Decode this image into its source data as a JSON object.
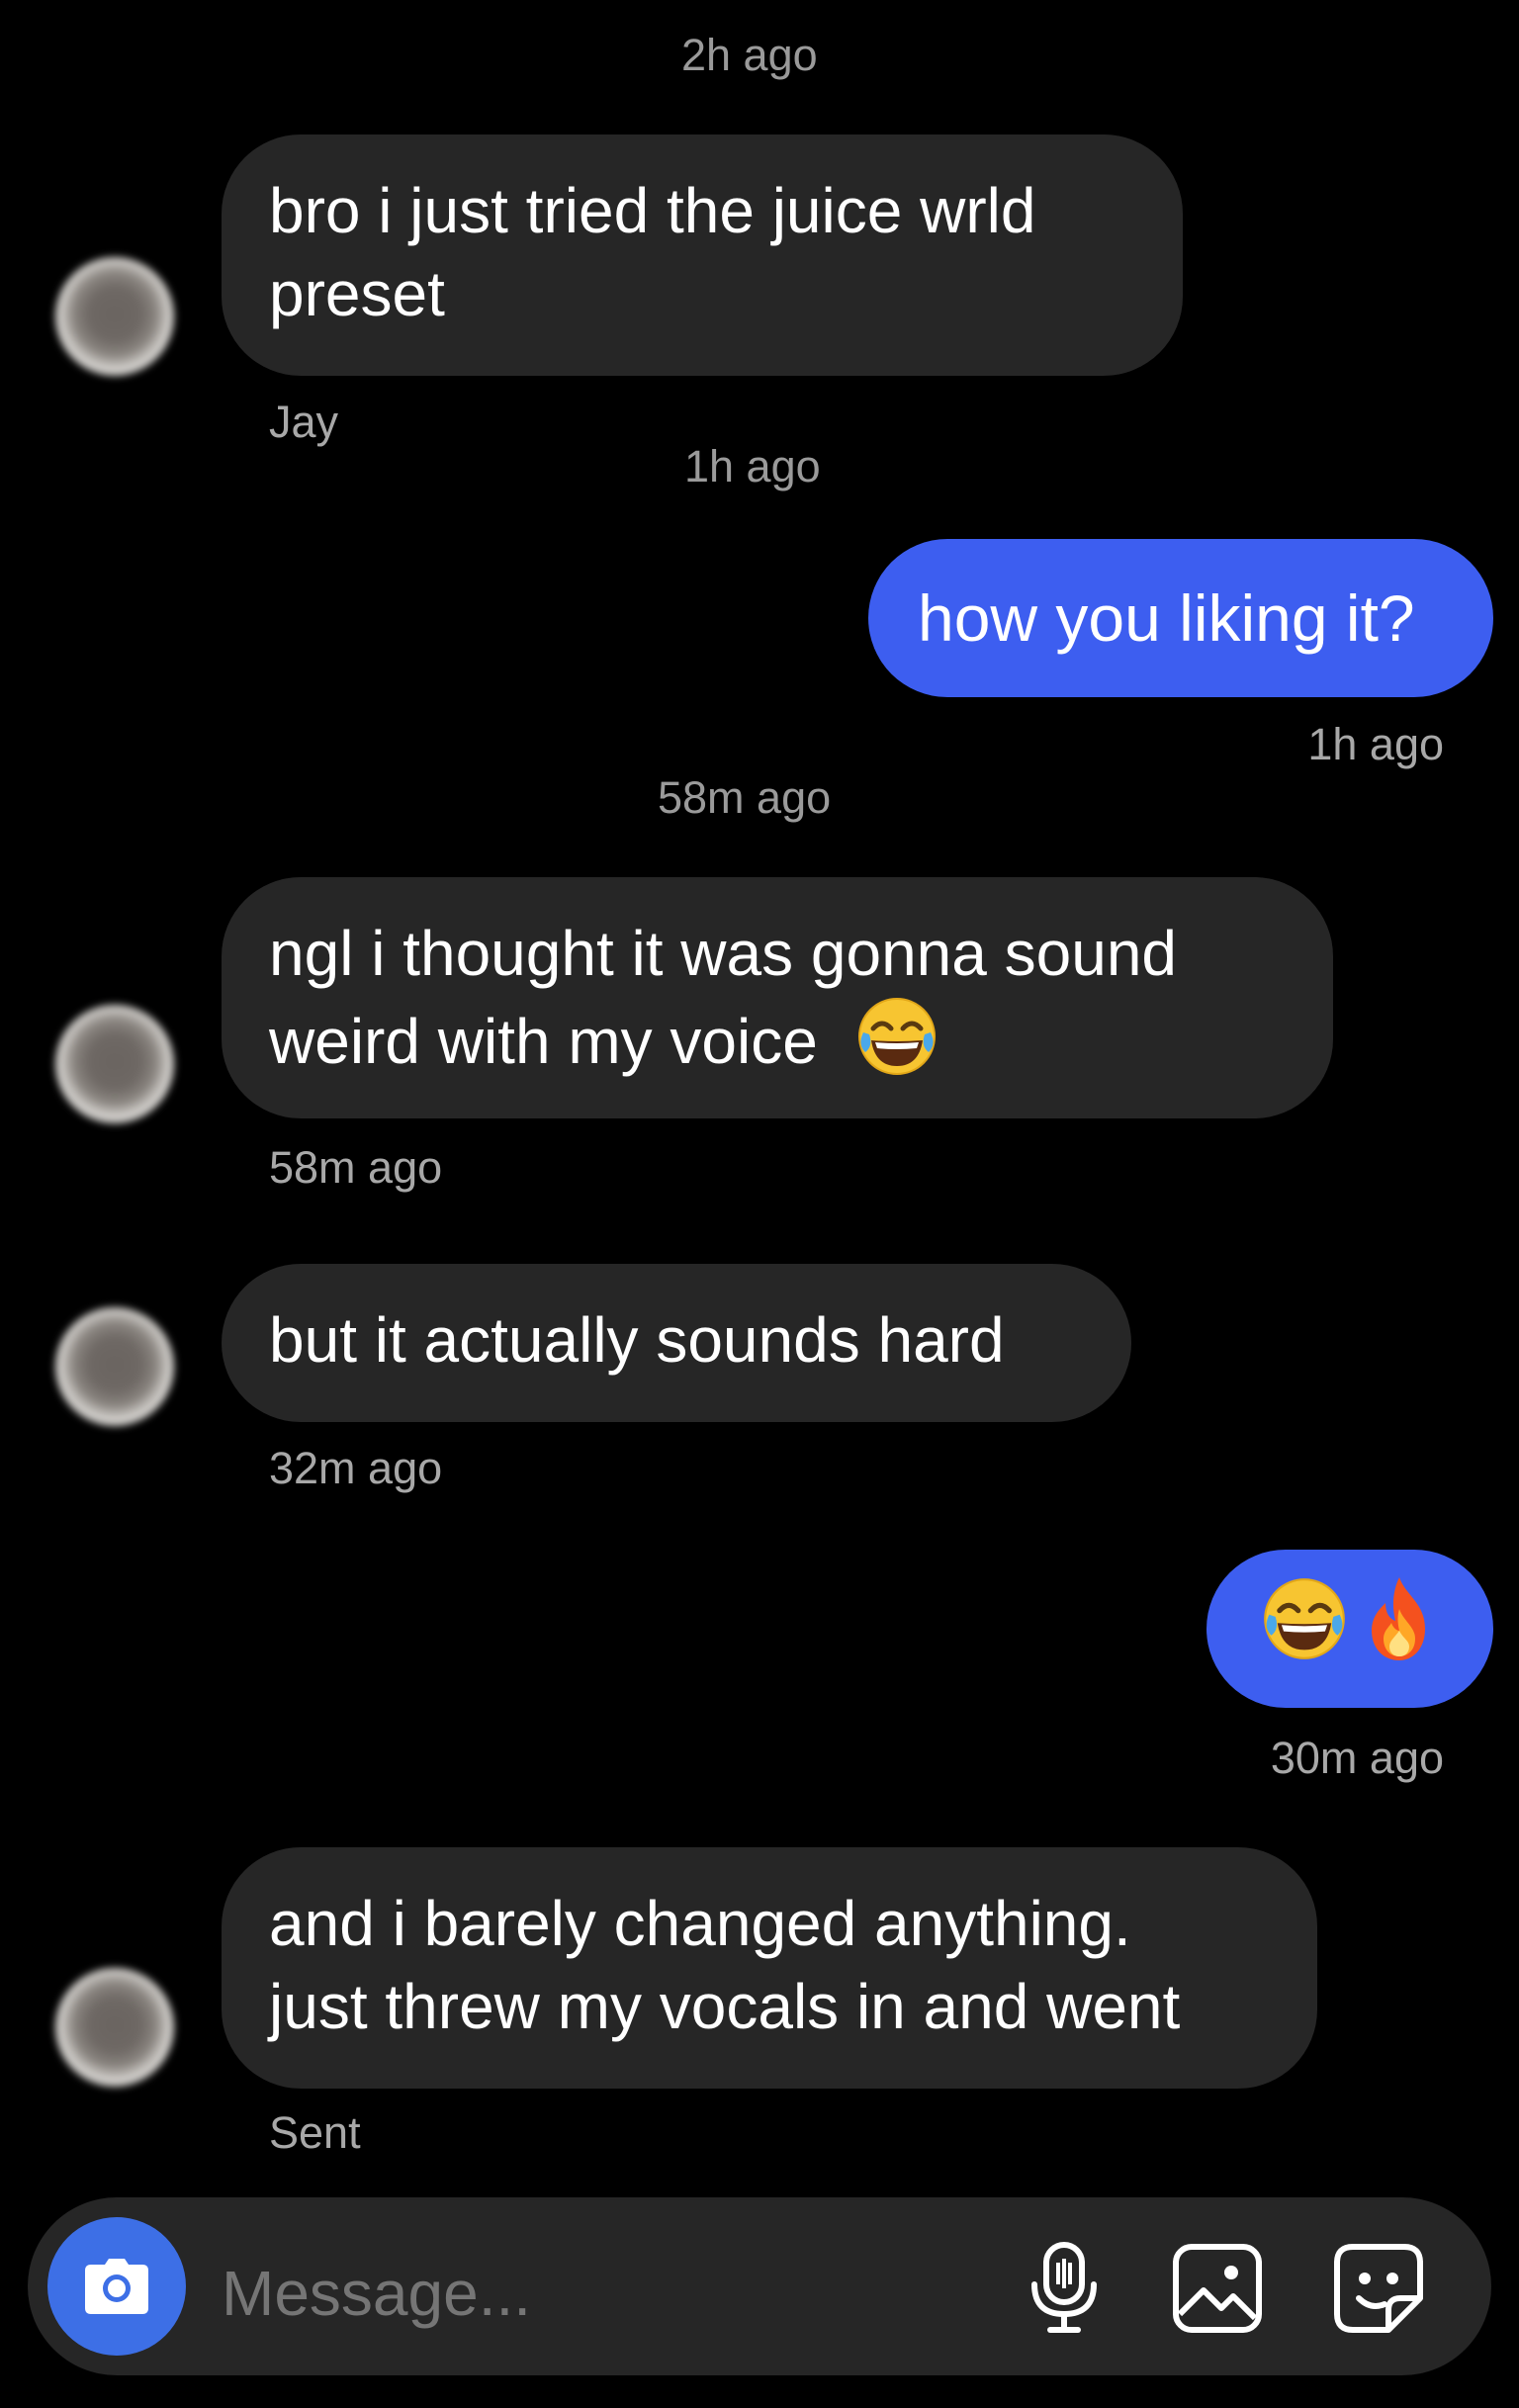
{
  "thread": {
    "messages": [
      {
        "timestamp": "2h ago",
        "sender": "Jay",
        "direction": "incoming",
        "lines": [
          "bro i just tried the juice wrld",
          "preset"
        ]
      },
      {
        "timestamp": "1h ago",
        "direction": "outgoing",
        "text": "how you liking it?",
        "status": "1h ago"
      },
      {
        "timestamp": "58m ago",
        "direction": "incoming",
        "lines": [
          "ngl i thought it was gonna sound",
          "weird with my voice"
        ],
        "emoji": "face-with-tears-of-joy",
        "meta": "58m ago"
      },
      {
        "direction": "incoming",
        "text": "but it actually sounds hard",
        "meta": "32m ago"
      },
      {
        "direction": "outgoing",
        "emojis": [
          "face-with-tears-of-joy",
          "fire"
        ],
        "status": "30m ago"
      },
      {
        "direction": "incoming",
        "lines": [
          "and i barely changed anything.",
          "just threw my vocals in and went"
        ],
        "meta": "Sent"
      }
    ]
  },
  "composer": {
    "placeholder": "Message...",
    "icons": [
      "camera-icon",
      "microphone-icon",
      "gallery-icon",
      "sticker-icon"
    ]
  },
  "colors": {
    "background": "#000000",
    "incoming_bubble": "#262626",
    "outgoing_bubble": "#3d5ef0",
    "camera_button": "#3d6fe6",
    "timestamp_text": "#9a9a9a"
  }
}
